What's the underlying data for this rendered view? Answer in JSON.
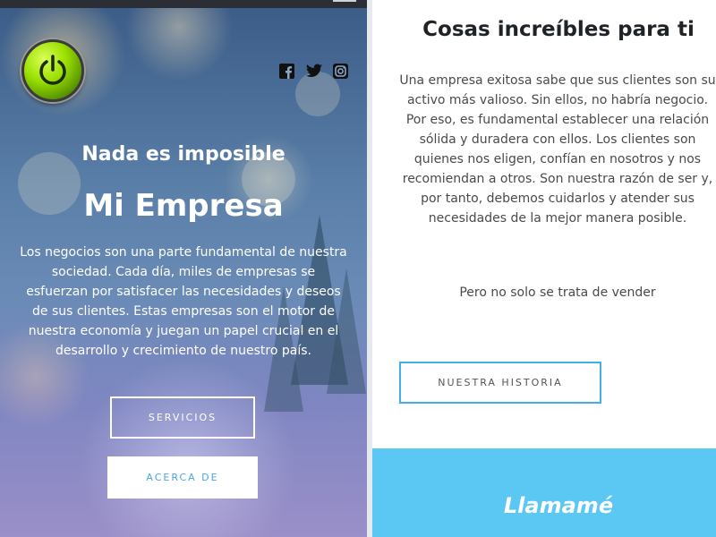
{
  "hero": {
    "tagline": "Nada es imposible",
    "brand": "Mi Empresa",
    "intro": "Los negocios son una parte fundamental de nuestra sociedad. Cada día, miles de empresas se esfuerzan por satisfacer las necesidades y deseos de sus clientes. Estas empresas son el motor de nuestra economía y juegan un papel crucial en el desarrollo y crecimiento de nuestro país.",
    "services_label": "SERVICIOS",
    "about_label": "ACERCA DE",
    "social": [
      "facebook-icon",
      "twitter-icon",
      "instagram-icon"
    ]
  },
  "content": {
    "title": "Cosas increíbles para ti",
    "body": "Una empresa exitosa sabe que sus clientes son su activo más valioso. Sin ellos, no habría negocio. Por eso, es fundamental establecer una relación sólida y duradera con ellos. Los clientes son quienes nos eligen, confían en nosotros y nos recomiendan a otros. Son nuestra razón de ser y, por tanto, debemos cuidarlos y atender sus necesidades de la mejor manera posible.",
    "subline": "Pero no solo se trata de vender",
    "history_label": "NUESTRA HISTORIA"
  },
  "call": {
    "label": "Llamamé"
  },
  "colors": {
    "accent": "#42b0e6",
    "banner": "#5bc7f3",
    "power_green": "#9be000"
  }
}
